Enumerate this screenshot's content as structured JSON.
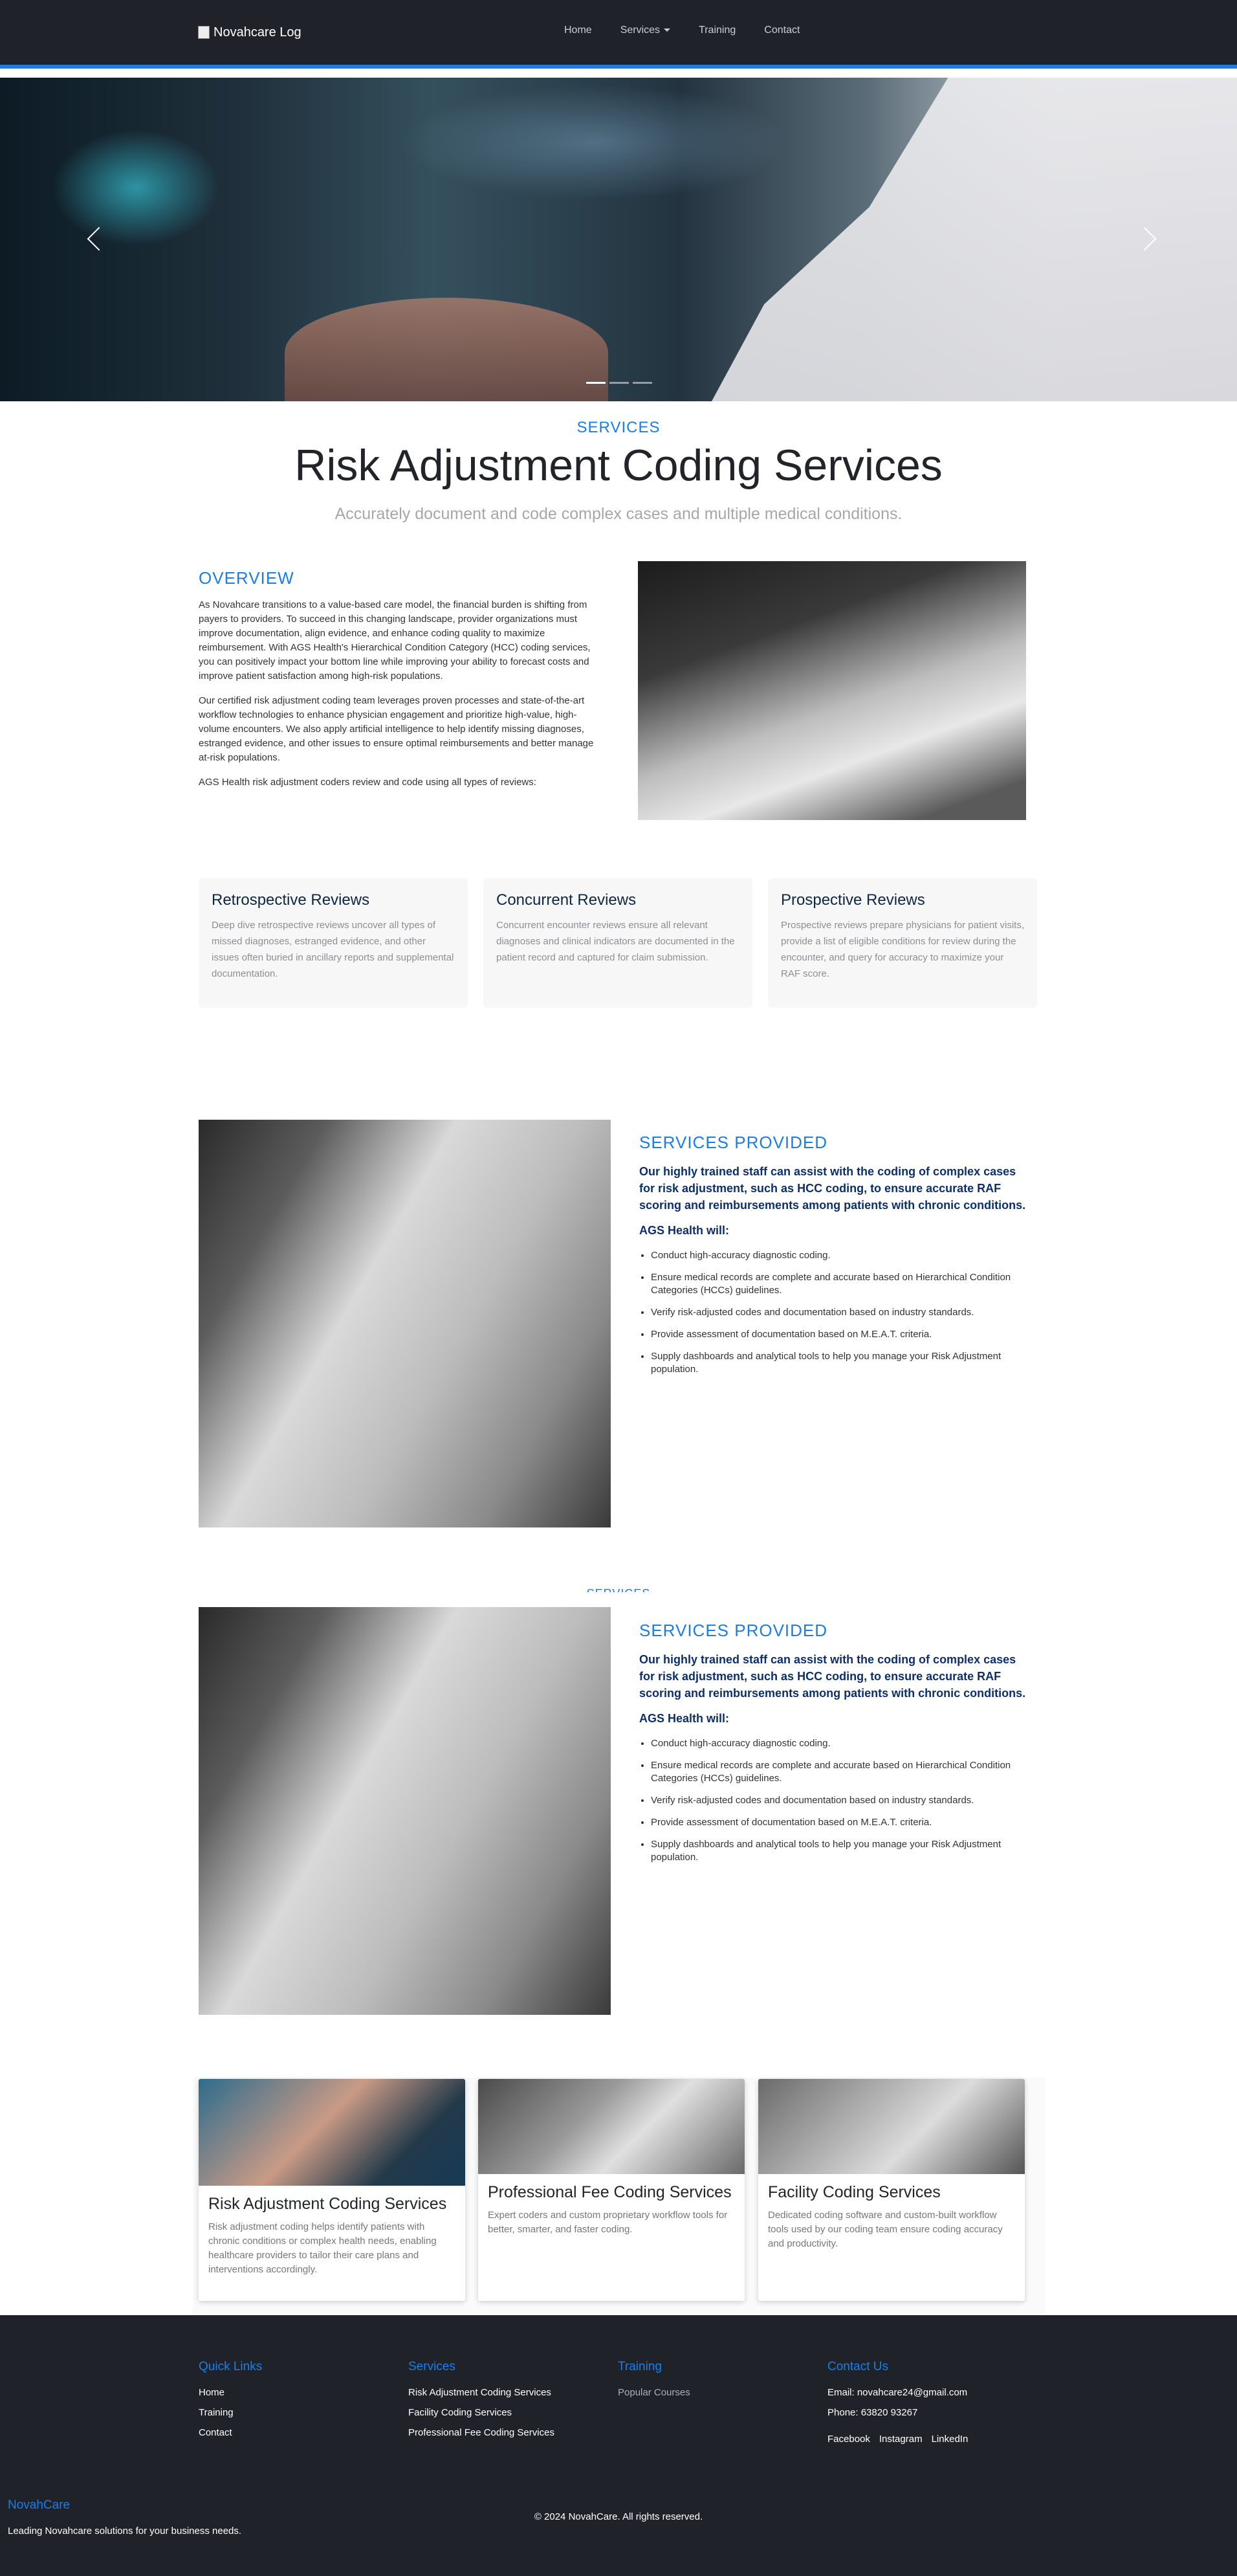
{
  "nav": {
    "logo_alt": "Novahcare Log",
    "links": [
      "Home",
      "Services",
      "Training",
      "Contact"
    ]
  },
  "hero": {
    "slides_total": 3,
    "active_slide": 1
  },
  "header": {
    "kicker": "SERVICES",
    "title": "Risk Adjustment Coding Services",
    "subtitle": "Accurately document and code complex cases and multiple medical conditions."
  },
  "overview": {
    "heading": "OVERVIEW",
    "paragraphs": [
      "As Novahcare transitions to a value-based care model, the financial burden is shifting from payers to providers. To succeed in this changing landscape, provider organizations must improve documentation, align evidence, and enhance coding quality to maximize reimbursement. With AGS Health's Hierarchical Condition Category (HCC) coding services, you can positively impact your bottom line while improving your ability to forecast costs and improve patient satisfaction among high-risk populations.",
      "Our certified risk adjustment coding team leverages proven processes and state-of-the-art workflow technologies to enhance physician engagement and prioritize high-value, high-volume encounters. We also apply artificial intelligence to help identify missing diagnoses, estranged evidence, and other issues to ensure optimal reimbursements and better manage at-risk populations.",
      "AGS Health risk adjustment coders review and code using all types of reviews:"
    ]
  },
  "reviews": [
    {
      "title": "Retrospective Reviews",
      "text": "Deep dive retrospective reviews uncover all types of missed diagnoses, estranged evidence, and other issues often buried in ancillary reports and supplemental documentation."
    },
    {
      "title": "Concurrent Reviews",
      "text": "Concurrent encounter reviews ensure all relevant diagnoses and clinical indicators are documented in the patient record and captured for claim submission."
    },
    {
      "title": "Prospective Reviews",
      "text": "Prospective reviews prepare physicians for patient visits, provide a list of eligible conditions for review during the encounter, and query for accuracy to maximize your RAF score."
    }
  ],
  "services_provided": {
    "heading": "SERVICES PROVIDED",
    "lead": "Our highly trained staff can assist with the coding of complex cases for risk adjustment, such as HCC coding, to ensure accurate RAF scoring and reimbursements among patients with chronic conditions.",
    "subheading": "AGS Health will:",
    "items": [
      "Conduct high-accuracy diagnostic coding.",
      "Ensure medical records are complete and accurate based on Hierarchical Condition Categories (HCCs) guidelines.",
      "Verify risk-adjusted codes and documentation based on industry standards.",
      "Provide assessment of documentation based on M.E.A.T. criteria.",
      "Supply dashboards and analytical tools to help you manage your Risk Adjustment population."
    ]
  },
  "service_cards": [
    {
      "title": "Risk Adjustment Coding Services",
      "text": "Risk adjustment coding helps identify patients with chronic conditions or complex health needs, enabling healthcare providers to tailor their care plans and interventions accordingly."
    },
    {
      "title": "Professional Fee Coding Services",
      "text": "Expert coders and custom proprietary workflow tools for better, smarter, and faster coding."
    },
    {
      "title": "Facility Coding Services",
      "text": "Dedicated coding software and custom-built workflow tools used by our coding team ensure coding accuracy and productivity."
    }
  ],
  "footer": {
    "quick_links": {
      "heading": "Quick Links",
      "items": [
        "Home",
        "Training",
        "Contact"
      ]
    },
    "services": {
      "heading": "Services",
      "items": [
        "Risk Adjustment Coding Services",
        "Facility Coding Services",
        "Professional Fee Coding Services"
      ]
    },
    "training": {
      "heading": "Training",
      "items": [
        "Popular Courses"
      ]
    },
    "contact": {
      "heading": "Contact Us",
      "email": "Email: novahcare24@gmail.com",
      "phone": "Phone: 63820 93267",
      "social": [
        "Facebook",
        "Instagram",
        "LinkedIn"
      ]
    },
    "brand": "NovahCare",
    "tagline": "Leading Novahcare solutions for your business needs.",
    "copyright": "© 2024 NovahCare. All rights reserved."
  },
  "colors": {
    "accent": "#1a7ee8",
    "dark": "#1f2329",
    "navy": "#0d2f6b"
  },
  "icons": [
    "chevron-left-icon",
    "chevron-right-icon",
    "caret-down-icon"
  ]
}
